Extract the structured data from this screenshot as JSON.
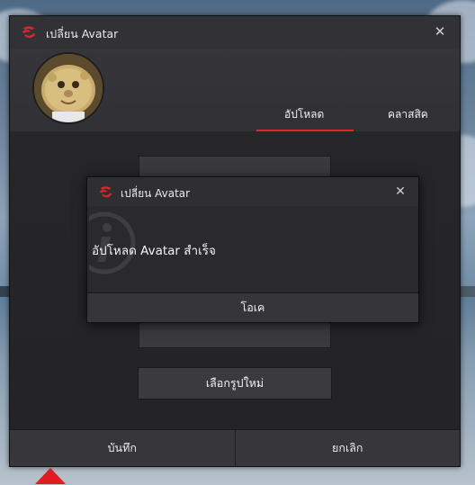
{
  "window": {
    "title": "เปลี่ยน Avatar",
    "close_icon": "close-icon"
  },
  "tabs": [
    {
      "label": "อัปโหลด",
      "active": true
    },
    {
      "label": "คลาสสิค",
      "active": false
    }
  ],
  "buttons": {
    "choose_image": "เลือกรูปใหม่",
    "save": "บันทึก",
    "cancel": "ยกเลิก"
  },
  "dialog": {
    "title": "เปลี่ยน Avatar",
    "message": "อัปโหลด Avatar สำเร็จ",
    "ok": "โอเค",
    "icon": "info-icon"
  },
  "colors": {
    "accent": "#e0242e",
    "window_bg": "#2c2c30"
  }
}
